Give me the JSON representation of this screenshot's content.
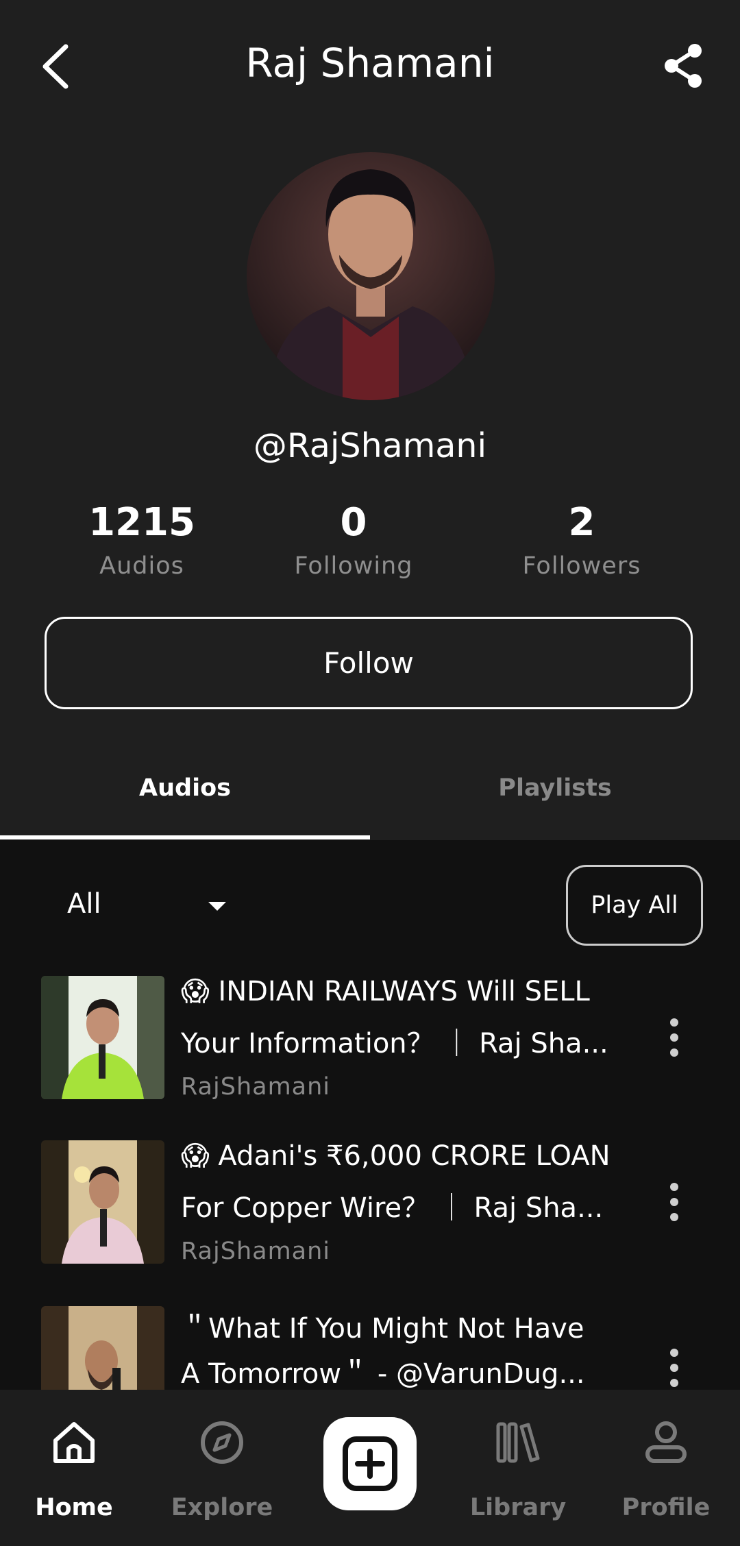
{
  "header": {
    "title": "Raj Shamani"
  },
  "profile": {
    "handle": "@RajShamani",
    "stats": [
      {
        "value": "1215",
        "label": "Audios"
      },
      {
        "value": "0",
        "label": "Following"
      },
      {
        "value": "2",
        "label": "Followers"
      }
    ],
    "follow_label": "Follow"
  },
  "tabs": [
    {
      "label": "Audios",
      "active": true
    },
    {
      "label": "Playlists",
      "active": false
    }
  ],
  "filter": {
    "selected": "All"
  },
  "play_all_label": "Play All",
  "audios": [
    {
      "line1": "😱 INDIAN RAILWAYS Will SELL",
      "line2": "Your Information？ ｜ Raj Sha...",
      "channel": "RajShamani"
    },
    {
      "line1": "😱 Adani's ₹6,000 CRORE LOAN",
      "line2": "For Copper Wire？ ｜ Raj Sha...",
      "channel": "RajShamani"
    },
    {
      "line1": "＂What If You Might Not Have",
      "line2": "A Tomorrow＂ - @VarunDug...",
      "channel": ""
    }
  ],
  "nav": [
    {
      "label": "Home",
      "icon": "home-icon",
      "active": true
    },
    {
      "label": "Explore",
      "icon": "compass-icon",
      "active": false
    },
    {
      "label": "Library",
      "icon": "library-icon",
      "active": false
    },
    {
      "label": "Profile",
      "icon": "user-icon",
      "active": false
    }
  ],
  "colors": {
    "background": "#111111",
    "surface": "#1f1f1f",
    "muted_text": "#8f8f8f"
  }
}
